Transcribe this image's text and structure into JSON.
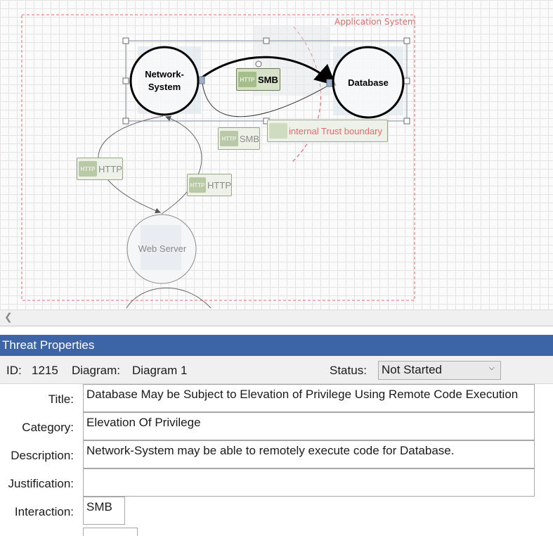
{
  "diagram": {
    "boundaries": {
      "application_system": "Application System",
      "internal_trust": "internal Trust boundary"
    },
    "nodes": {
      "network_system": "Network-\nSystem",
      "database": "Database",
      "web_server": "Web Server"
    },
    "flows": {
      "smb_selected": "SMB",
      "smb": "SMB",
      "http_left": "HTTP",
      "http_right": "HTTP",
      "chip": "HTTP"
    },
    "colors": {
      "boundary": "#e46b6b",
      "selection": "#7d8fa3",
      "flow_chip": "#b9c9a7"
    }
  },
  "panel": {
    "title": "Threat Properties",
    "id_label": "ID:",
    "id_value": "1215",
    "diagram_label": "Diagram:",
    "diagram_value": "Diagram 1",
    "status_label": "Status:",
    "status_value": "Not Started",
    "fields": {
      "title_label": "Title:",
      "title_value": "Database May be Subject to Elevation of Privilege Using Remote Code Execution",
      "category_label": "Category:",
      "category_value": "Elevation Of Privilege",
      "description_label": "Description:",
      "description_value": "Network-System may be able to remotely execute code for Database.",
      "justification_label": "Justification:",
      "justification_value": "",
      "interaction_label": "Interaction:",
      "interaction_value": "SMB"
    }
  }
}
